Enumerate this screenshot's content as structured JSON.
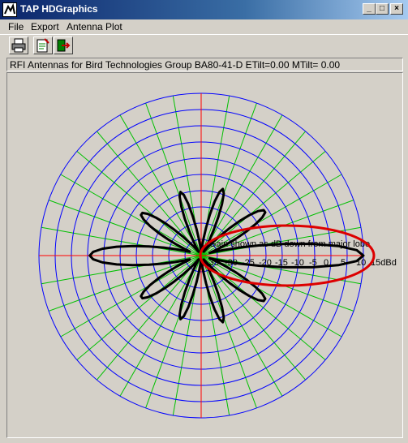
{
  "window": {
    "title": "TAP HDGraphics",
    "buttons": {
      "minimize": "_",
      "maximize": "□",
      "close": "×"
    }
  },
  "menu": {
    "items": [
      "File",
      "Export",
      "Antenna Plot"
    ]
  },
  "toolbar": {
    "buttons": [
      "printer-icon",
      "report-icon",
      "exit-icon"
    ]
  },
  "info": {
    "text": "RFI Antennas for Bird Technologies Group BA80-41-D ETilt=0.00 MTilt= 0.00"
  },
  "plot": {
    "annotation": "Gain shown as dB down from major lobe",
    "scale_labels": [
      "-35",
      "-30",
      "-25",
      "-20",
      "-15",
      "-10",
      "-5",
      "0",
      "5",
      "10",
      "15dBd"
    ],
    "grid_color": "#00c000",
    "ring_color": "#0000ff",
    "axis_color": "#ff0000",
    "highlight_color": "#dd0000",
    "pattern_color": "#000000"
  }
}
